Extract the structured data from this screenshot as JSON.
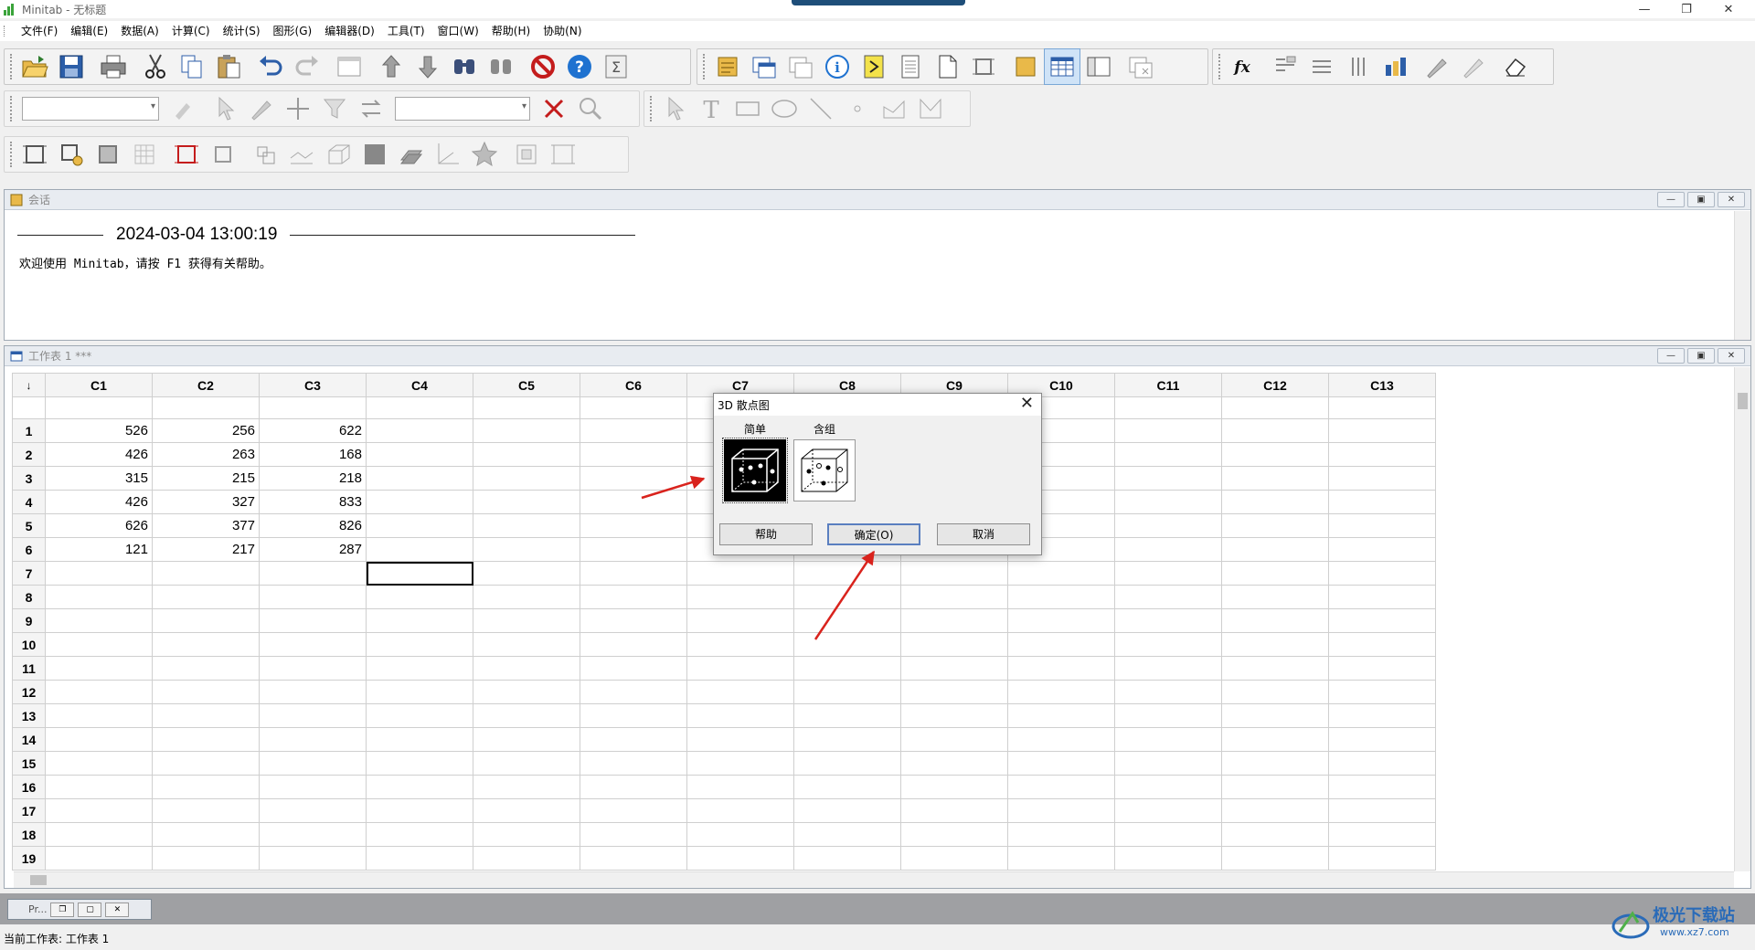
{
  "window": {
    "title": "Minitab - 无标题",
    "controls": {
      "minimize": "—",
      "restore": "❐",
      "close": "✕"
    }
  },
  "menu": [
    "文件(F)",
    "编辑(E)",
    "数据(A)",
    "计算(C)",
    "统计(S)",
    "图形(G)",
    "编辑器(D)",
    "工具(T)",
    "窗口(W)",
    "帮助(H)",
    "协助(N)"
  ],
  "session": {
    "title": "会话",
    "timestamp": "2024-03-04 13:00:19",
    "message": "欢迎使用 Minitab，请按 F1 获得有关帮助。"
  },
  "worksheet": {
    "title": "工作表 1 ***",
    "corner": "↓",
    "columns": [
      "C1",
      "C2",
      "C3",
      "C4",
      "C5",
      "C6",
      "C7",
      "C8",
      "C9",
      "C10",
      "C11",
      "C12",
      "C13"
    ],
    "row_numbers": [
      "1",
      "2",
      "3",
      "4",
      "5",
      "6",
      "7",
      "8",
      "9",
      "10",
      "11",
      "12",
      "13",
      "14",
      "15",
      "16",
      "17",
      "18",
      "19"
    ],
    "rows": [
      [
        "526",
        "256",
        "622"
      ],
      [
        "426",
        "263",
        "168"
      ],
      [
        "315",
        "215",
        "218"
      ],
      [
        "426",
        "327",
        "833"
      ],
      [
        "626",
        "377",
        "826"
      ],
      [
        "121",
        "217",
        "287"
      ]
    ],
    "selected_cell": {
      "row": "7",
      "column": "C4"
    }
  },
  "minimized_window": {
    "label": "Pr...",
    "buttons": [
      "❐",
      "▢",
      "✕"
    ]
  },
  "status_bar": "当前工作表: 工作表 1",
  "dialog": {
    "title": "3D 散点图",
    "options": [
      {
        "label": "简单",
        "selected": true
      },
      {
        "label": "含组",
        "selected": false
      }
    ],
    "buttons": {
      "help": "帮助",
      "ok": "确定(O)",
      "cancel": "取消"
    }
  },
  "watermark": {
    "name": "极光下载站",
    "url": "www.xz7.com"
  },
  "colors": {
    "annotation_arrow": "#d9231d",
    "accent": "#1e4e79",
    "selection": "#000000"
  }
}
